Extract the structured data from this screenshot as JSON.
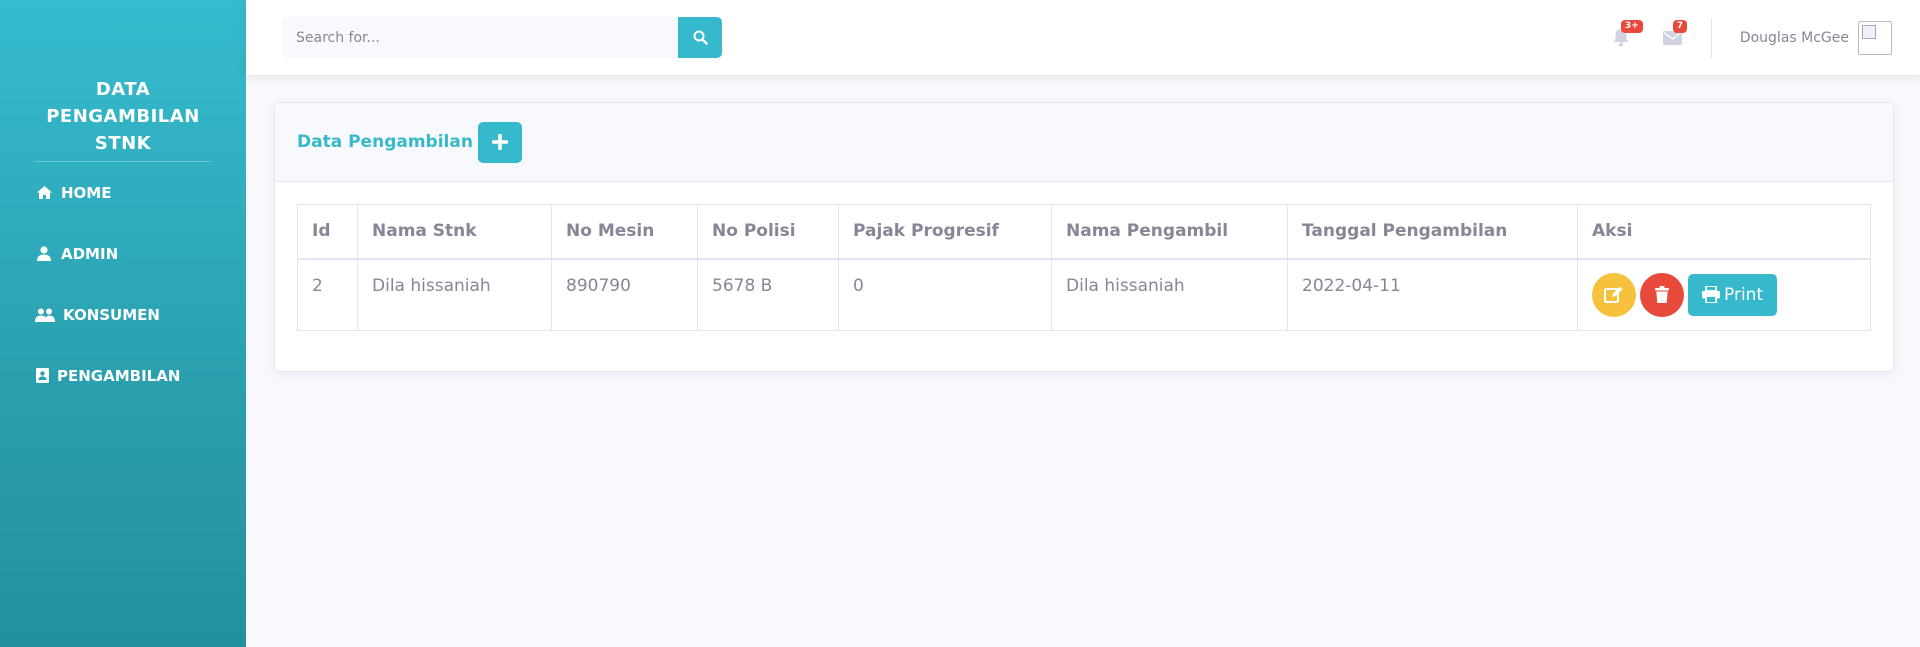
{
  "sidebar": {
    "brand": "DATA PENGAMBILAN STNK",
    "items": [
      {
        "label": "HOME",
        "icon": "home-icon"
      },
      {
        "label": "ADMIN",
        "icon": "user-icon"
      },
      {
        "label": "KONSUMEN",
        "icon": "users-icon"
      },
      {
        "label": "PENGAMBILAN",
        "icon": "address-book-icon"
      }
    ]
  },
  "topbar": {
    "search_placeholder": "Search for...",
    "alerts_badge": "3+",
    "messages_badge": "7",
    "user_name": "Douglas McGee"
  },
  "card": {
    "title": "Data Pengambilan",
    "columns": [
      "Id",
      "Nama Stnk",
      "No Mesin",
      "No Polisi",
      "Pajak Progresif",
      "Nama Pengambil",
      "Tanggal Pengambilan",
      "Aksi"
    ],
    "rows": [
      {
        "id": "2",
        "nama_stnk": "Dila hissaniah",
        "no_mesin": "890790",
        "no_polisi": "5678 B",
        "pajak": "0",
        "nama_pengambil": "Dila hissaniah",
        "tanggal": "2022-04-11"
      }
    ],
    "print_label": "Print"
  },
  "colors": {
    "accent": "#36b9cc",
    "warning": "#f6c23e",
    "danger": "#e74a3b"
  }
}
